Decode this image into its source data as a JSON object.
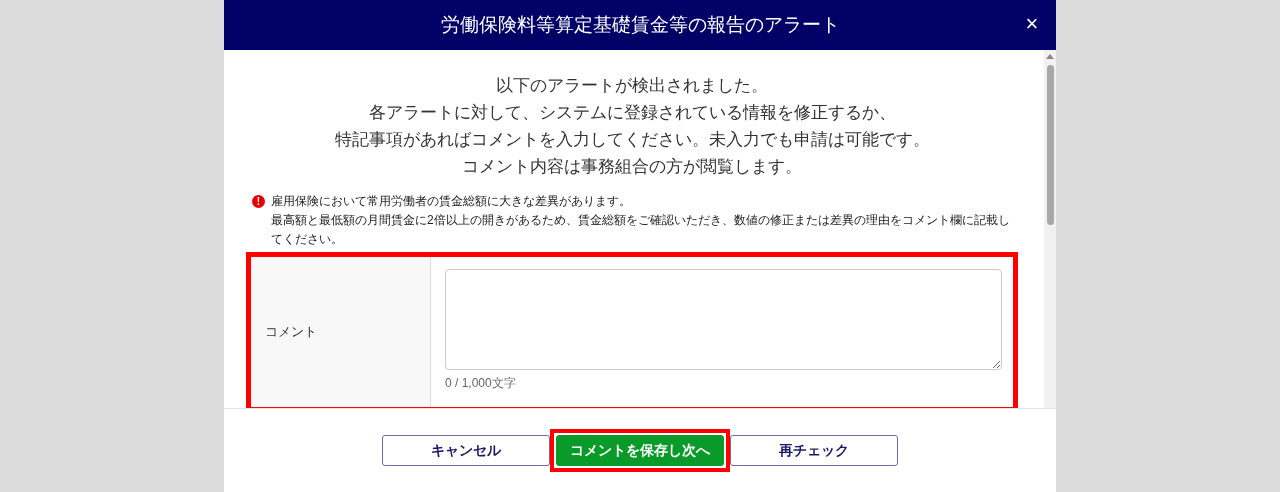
{
  "dialog": {
    "title": "労働保険料等算定基礎賃金等の報告のアラート",
    "close": "×"
  },
  "intro": [
    "以下のアラートが検出されました。",
    "各アラートに対して、システムに登録されている情報を修正するか、",
    "特記事項があればコメントを入力してください。未入力でも申請は可能です。",
    "コメント内容は事務組合の方が閲覧します。"
  ],
  "alert": {
    "icon": "!",
    "message": "雇用保険において常用労働者の賃金総額に大きな差異があります。",
    "detail": "最高額と最低額の月間賃金に2倍以上の開きがあるため、賃金総額をご確認いただき、数値の修正または差異の理由をコメント欄に記載してください。"
  },
  "comment": {
    "label": "コメント",
    "counter": "0 / 1,000文字",
    "highlighted": true
  },
  "buttons": [
    {
      "label": "キャンセル",
      "kind": "outline",
      "highlighted": false
    },
    {
      "label": "コメントを保存し次へ",
      "kind": "primary",
      "highlighted": true
    },
    {
      "label": "再チェック",
      "kind": "outline",
      "highlighted": false
    }
  ]
}
